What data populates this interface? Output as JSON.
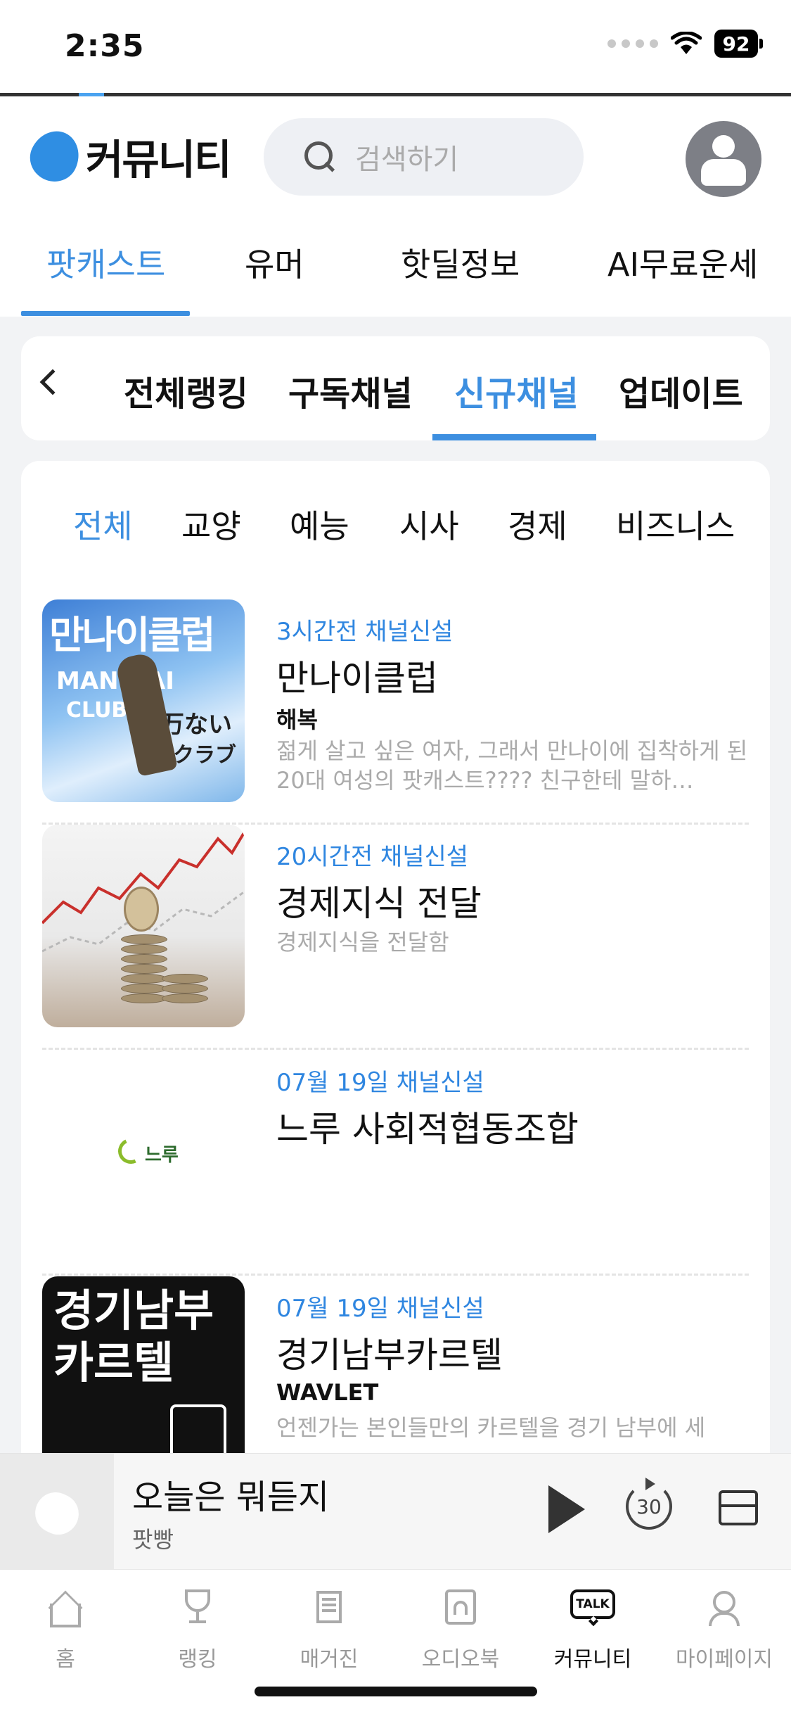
{
  "status_bar": {
    "time": "2:35",
    "battery": "92"
  },
  "header": {
    "logo_text": "커뮤니티",
    "search_placeholder": "검색하기"
  },
  "top_tabs": [
    {
      "label": "팟캐스트",
      "active": true
    },
    {
      "label": "유머",
      "active": false
    },
    {
      "label": "핫딜정보",
      "active": false
    },
    {
      "label": "AI무료운세",
      "active": false
    }
  ],
  "sub_tabs": [
    {
      "label": "전체랭킹",
      "active": false
    },
    {
      "label": "구독채널",
      "active": false
    },
    {
      "label": "신규채널",
      "active": true
    },
    {
      "label": "업데이트",
      "active": false
    }
  ],
  "categories": [
    {
      "label": "전체",
      "active": true
    },
    {
      "label": "교양",
      "active": false
    },
    {
      "label": "예능",
      "active": false
    },
    {
      "label": "시사",
      "active": false
    },
    {
      "label": "경제",
      "active": false
    },
    {
      "label": "비즈니스",
      "active": false
    }
  ],
  "channels": [
    {
      "time": "3시간전 채널신설",
      "title": "만나이클럽",
      "author": "해복",
      "description": "젊게 살고 싶은 여자, 그래서 만나이에 집착하게 된 20대 여성의 팟캐스트???? 친구한테 말하…",
      "thumb_text": "만나이클럽 MAN NAI CLUB 万ないクラブ"
    },
    {
      "time": "20시간전 채널신설",
      "title": "경제지식 전달",
      "author": "",
      "description": "경제지식을 전달함"
    },
    {
      "time": "07월 19일 채널신설",
      "title": "느루 사회적협동조합",
      "author": "",
      "description": "",
      "thumb_text": "느루"
    },
    {
      "time": "07월 19일 채널신설",
      "title": "경기남부카르텔",
      "author": "WAVLET",
      "description": "언젠가는 본인들만의 카르텔을 경기 남부에 세",
      "thumb_text": "경기남부 카르텔"
    }
  ],
  "player": {
    "title": "오늘은 뭐듣지",
    "subtitle": "팟빵",
    "skip_seconds": "30"
  },
  "bottom_nav": [
    {
      "label": "홈",
      "icon": "home-icon"
    },
    {
      "label": "랭킹",
      "icon": "trophy-icon"
    },
    {
      "label": "매거진",
      "icon": "magazine-icon"
    },
    {
      "label": "오디오북",
      "icon": "audiobook-icon"
    },
    {
      "label": "커뮤니티",
      "icon": "talk-icon",
      "active": true
    },
    {
      "label": "마이페이지",
      "icon": "mypage-icon"
    }
  ],
  "talk_icon_text": "TALK",
  "colors": {
    "accent": "#3d8fe0",
    "time_text": "#2f86e0"
  }
}
